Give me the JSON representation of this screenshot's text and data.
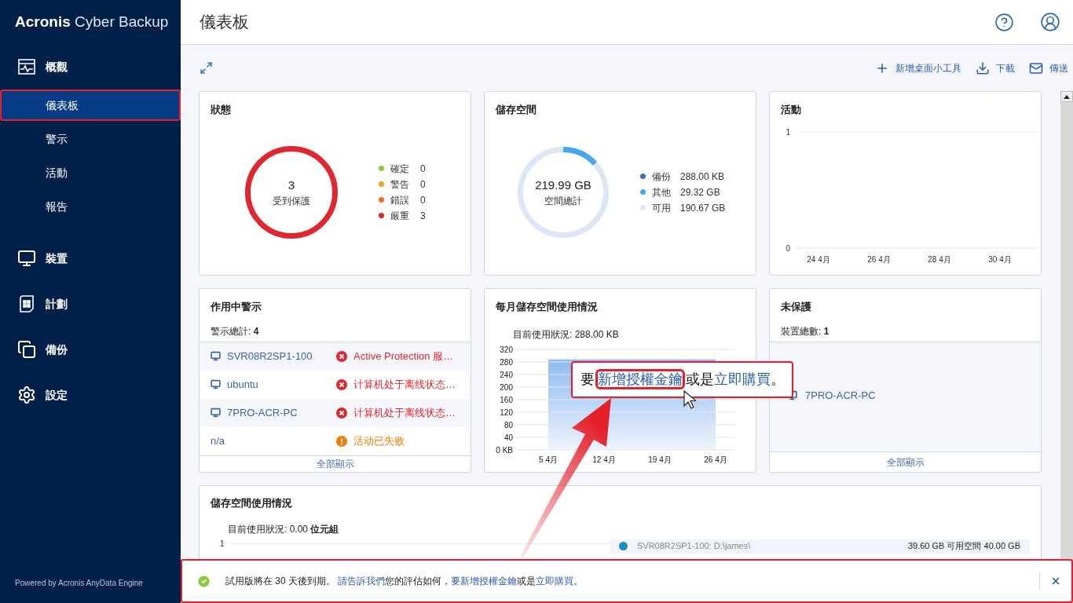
{
  "app": {
    "logo_bold": "Acronis",
    "logo_light": "Cyber Backup",
    "powered_by": "Powered by Acronis AnyData Engine"
  },
  "sidebar": {
    "groups": [
      {
        "kind": "overview",
        "label": "概觀",
        "items": [
          {
            "label": "儀表板",
            "selected": true,
            "highlighted": true
          },
          {
            "label": "警示",
            "selected": false,
            "highlighted": false
          },
          {
            "label": "活動",
            "selected": false,
            "highlighted": false
          },
          {
            "label": "報告",
            "selected": false,
            "highlighted": false
          }
        ]
      },
      {
        "kind": "devices",
        "label": "裝置"
      },
      {
        "kind": "plans",
        "label": "計劃"
      },
      {
        "kind": "backup",
        "label": "備份"
      },
      {
        "kind": "settings",
        "label": "設定"
      }
    ]
  },
  "header": {
    "title": "儀表板"
  },
  "toolbar": {
    "actions": [
      {
        "kind": "add",
        "label": "新增桌面小工具"
      },
      {
        "kind": "download",
        "label": "下載"
      },
      {
        "kind": "send",
        "label": "傳送"
      }
    ]
  },
  "status": {
    "title": "狀態",
    "total": "3",
    "total_label": "受到保護",
    "legend": [
      {
        "label": "確定",
        "count": "0",
        "color": "#8cc63f"
      },
      {
        "label": "警告",
        "count": "0",
        "color": "#f7a21b"
      },
      {
        "label": "錯誤",
        "count": "0",
        "color": "#f26d21"
      },
      {
        "label": "嚴重",
        "count": "3",
        "color": "#e0262e"
      }
    ]
  },
  "storage": {
    "title": "儲存空間",
    "total": "219.99 GB",
    "total_label": "空間總計",
    "legend": [
      {
        "label": "備份",
        "value": "288.00 KB",
        "color": "#3d6cb0"
      },
      {
        "label": "其他",
        "value": "29.32 GB",
        "color": "#45a7f2"
      },
      {
        "label": "可用",
        "value": "190.67 GB",
        "color": "#dde6f5"
      }
    ],
    "level": 0.133
  },
  "activity": {
    "title": "活動",
    "chart_data": {
      "type": "line",
      "categories": [
        "24 4月",
        "26 4月",
        "28 4月",
        "30 4月"
      ],
      "ylim": [
        0,
        1
      ],
      "yticks": [
        0,
        1
      ]
    }
  },
  "alerts": {
    "title": "作用中警示",
    "total_label": "警示總計:",
    "total": "4",
    "show_all": "全部顯示",
    "rows": [
      {
        "device": "SVR08R2SP1-100",
        "device_icon": true,
        "kind": "critical",
        "message": "Active Protection 服…"
      },
      {
        "device": "ubuntu",
        "device_icon": true,
        "kind": "critical",
        "message": "计算机处于离线状态…"
      },
      {
        "device": "7PRO-ACR-PC",
        "device_icon": true,
        "kind": "critical",
        "message": "计算机处于离线状态…"
      },
      {
        "device": "n/a",
        "device_icon": false,
        "kind": "warning",
        "message": "活动已失败"
      }
    ]
  },
  "monthly": {
    "title": "每月儲存空間使用情況",
    "current_label": "目前使用狀況:",
    "current": "288.00 KB",
    "chart_data": {
      "type": "area",
      "categories": [
        "5 4月",
        "12 4月",
        "19 4月",
        "26 4月"
      ],
      "series": [
        {
          "color": "#8fbaf0",
          "values": [
            288,
            288,
            288,
            288
          ]
        }
      ],
      "grid": true,
      "ylim": [
        0,
        320
      ],
      "yticks": [
        {
          "value": 0,
          "label": "0 KB"
        },
        40,
        80,
        120,
        160,
        200,
        240,
        280,
        320
      ]
    }
  },
  "unprotected": {
    "title": "未保護",
    "total_label": "裝置總數:",
    "total": "1",
    "devices": [
      "7PRO-ACR-PC"
    ],
    "show_all": "全部顯示"
  },
  "usage": {
    "title": "儲存空間使用情況",
    "current_label": "目前使用狀況:",
    "current": "0.00",
    "unit": "位元組",
    "y_tick": "1",
    "locations": [
      {
        "name": "SVR08R2SP1-100: D:\\james\\",
        "size": "39.60 GB 可用空間 40.00 GB",
        "color": "#1b8fc0"
      }
    ]
  },
  "notice": {
    "highlighted": true,
    "segments": [
      {
        "kind": "text",
        "text": "試用版將在 30 天後到期。 "
      },
      {
        "kind": "link",
        "text": "請告訴我們"
      },
      {
        "kind": "text",
        "text": "您的評估如何，"
      },
      {
        "kind": "link",
        "text": "要新增授權金鑰"
      },
      {
        "kind": "text",
        "text": "或是"
      },
      {
        "kind": "link",
        "text": "立即購買"
      },
      {
        "kind": "text",
        "text": "。"
      }
    ]
  },
  "callout": {
    "segments": [
      {
        "kind": "text",
        "text": "要"
      },
      {
        "kind": "link",
        "text": "新增授權金鑰",
        "highlighted": true
      },
      {
        "kind": "text",
        "text": "或是"
      },
      {
        "kind": "link",
        "text": "立即購買",
        "highlighted": false
      },
      {
        "kind": "text",
        "text": "。"
      }
    ]
  }
}
